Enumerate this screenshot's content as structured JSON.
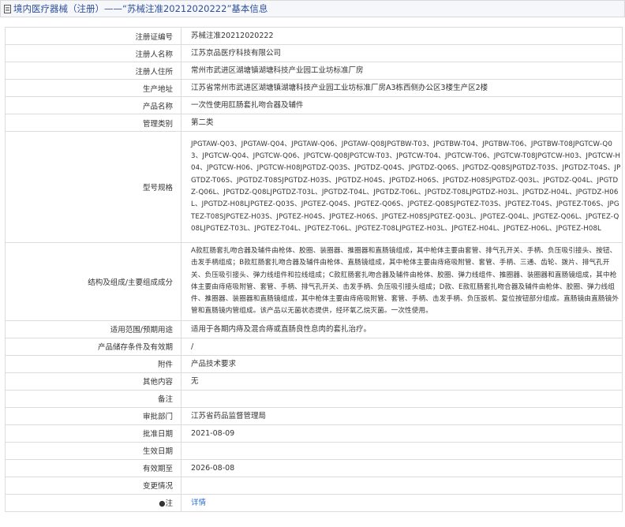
{
  "header": {
    "title": "境内医疗器械（注册）——“苏械注准20212020222”基本信息"
  },
  "rows": [
    {
      "label": "注册证编号",
      "value": "苏械注准20212020222"
    },
    {
      "label": "注册人名称",
      "value": "江苏京品医疗科技有限公司"
    },
    {
      "label": "注册人住所",
      "value": "常州市武进区湖塘镇湖塘科技产业园工业坊标准厂房"
    },
    {
      "label": "生产地址",
      "value": "江苏省常州市武进区湖塘镇湖塘科技产业园工业坊标准厂房A3栋西侧办公区3楼生产区2楼"
    },
    {
      "label": "产品名称",
      "value": "一次性使用肛肠套扎吻合器及辅件"
    },
    {
      "label": "管理类别",
      "value": "第二类"
    },
    {
      "label": "型号规格",
      "value": "JPGTAW-Q03、JPGTAW-Q04、JPGTAW-Q06、JPGTAW-Q08JPGTBW-T03、JPGTBW-T04、JPGTBW-T06、JPGTBW-T08JPGTCW-Q03、JPGTCW-Q04、JPGTCW-Q06、JPGTCW-Q08JPGTCW-T03、JPGTCW-T04、JPGTCW-T06、JPGTCW-T08JPGTCW-H03、JPGTCW-H04、JPGTCW-H06、JPGTCW-H08JPGTDZ-Q03S、JPGTDZ-Q04S、JPGTDZ-Q06S、JPGTDZ-Q08SJPGTDZ-T03S、JPGTDZ-T04S、JPGTDZ-T06S、JPGTDZ-T08SJPGTDZ-H03S、JPGTDZ-H04S、JPGTDZ-H06S、JPGTDZ-H08SJPGTDZ-Q03L、JPGTDZ-Q04L、JPGTDZ-Q06L、JPGTDZ-Q08LJPGTDZ-T03L、JPGTDZ-T04L、JPGTDZ-T06L、JPGTDZ-T08LJPGTDZ-H03L、JPGTDZ-H04L、JPGTDZ-H06L、JPGTDZ-H08LJPGTEZ-Q03S、JPGTEZ-Q04S、JPGTEZ-Q06S、JPGTEZ-Q08SJPGTEZ-T03S、JPGTEZ-T04S、JPGTEZ-T06S、JPGTEZ-T08SJPGTEZ-H03S、JPGTEZ-H04S、JPGTEZ-H06S、JPGTEZ-H08SJPGTEZ-Q03L、JPGTEZ-Q04L、JPGTEZ-Q06L、JPGTEZ-Q08LJPGTEZ-T03L、JPGTEZ-T04L、JPGTEZ-T06L、JPGTEZ-T08LJPGTEZ-H03L、JPGTEZ-H04L、JPGTEZ-H06L、JPGTEZ-H08L"
    },
    {
      "label": "结构及组成/主要组成成分",
      "value": "A款肛肠套扎吻合器及辅件由枪体、胶圈、装圈器、推圈器和直肠镜组成，其中枪体主要由套管、排气孔开关、手柄、负压吸引接头、按钮、击发手柄组成；B款肛肠套扎吻合器及辅件由枪体、直肠镜组成，其中枪体主要由痔疮吸附管、套管、手柄、三通、齿轮、拨片、排气孔开关、负压吸引接头、弹力线组件和拉线组成；C款肛肠套扎吻合器及辅件由枪体、胶圈、弹力线组件、推圈器、装圈器和直肠镜组成，其中枪体主要由痔疮吸附管、套管、手柄、排气孔开关、击发手柄、负压吸引接头组成；D款、E款肛肠套扎吻合器及辅件由枪体、胶圈、弹力线组件、推圈器、装圈器和直肠镜组成，其中枪体主要由痔疮吸附管、套管、手柄、击发手柄、负压扳机、复位按钮部分组成。直肠镜由直肠镜外管和直肠镜内管组成。该产品以无菌状态提供，经环氧乙烷灭菌。一次性使用。"
    },
    {
      "label": "适用范围/预期用途",
      "value": "适用于各期内痔及混合痔或直肠良性息肉的套扎治疗。"
    },
    {
      "label": "产品储存条件及有效期",
      "value": "/"
    },
    {
      "label": "附件",
      "value": "产品技术要求"
    },
    {
      "label": "其他内容",
      "value": "无"
    },
    {
      "label": "备注",
      "value": ""
    },
    {
      "label": "审批部门",
      "value": "江苏省药品监督管理局"
    },
    {
      "label": "批准日期",
      "value": "2021-08-09"
    },
    {
      "label": "生效日期",
      "value": ""
    },
    {
      "label": "有效期至",
      "value": "2026-08-08"
    },
    {
      "label": "变更情况",
      "value": ""
    },
    {
      "label": "●注",
      "value": "详情"
    }
  ]
}
